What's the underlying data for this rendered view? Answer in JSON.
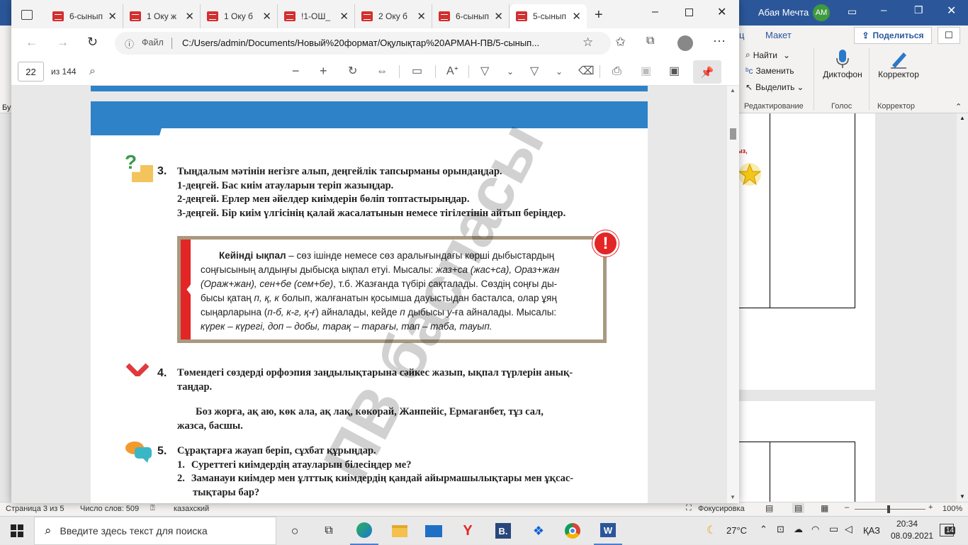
{
  "word": {
    "window_title": "Абая Мечта",
    "user_initials": "АМ",
    "tabs": [
      "ц",
      "Макет"
    ],
    "share_label": "Поделиться",
    "editing": {
      "find": "Найти",
      "replace": "Заменить",
      "select": "Выделить",
      "group": "Редактирование"
    },
    "voice": {
      "dictate": "Диктофон",
      "group": "Голос"
    },
    "editor": {
      "label": "Корректор",
      "group": "Корректор"
    },
    "left_cut": "Бу",
    "doc_fragment": "ыз,",
    "status": {
      "page": "Страница 3 из 5",
      "words": "Число слов: 509",
      "language": "казахский",
      "focus": "Фокусировка",
      "zoom": "100%"
    }
  },
  "edge": {
    "tabs": [
      "6-сынып",
      "1 Оку ж",
      "1 Оку б",
      "!1-ОШ_",
      "2 Оку б",
      "6-сынып",
      "5-сынып"
    ],
    "address": {
      "label": "Файл",
      "url": "C:/Users/admin/Documents/Новый%20формат/Оқулықтар%20АРМАН-ПВ/5-сынып..."
    },
    "pdf": {
      "page_current": "22",
      "page_total": "из 144"
    }
  },
  "pdf_page": {
    "task3": {
      "num": "3.",
      "lines": [
        "Тыңдалым мәтінін негізге алып, деңгейлік тапсырманы орындаңдар.",
        "1-деңгей. Бас киім атауларын теріп жазыңдар.",
        "2-деңгей. Ерлер мен әйелдер киімдерін бөліп топтастырыңдар.",
        "3-деңгей. Бір киім үлгісінің қалай жасалатынын немесе тігілетінін айтып беріңдер."
      ]
    },
    "rule": {
      "term": "Кейінді ықпал",
      "l1": " – сөз ішінде немесе сөз аралығындағы көрші дыбыстардың",
      "l2a": "соңғысының алдыңғы дыбысқа ықпал етуі. Мысалы: ",
      "l2b": "жаз+са (жас+са), Ораз+жан",
      "l3a": "(Ораж+жан), сен+бе (сем+бе)",
      "l3b": ", т.б. Жазғанда түбірі сақталады. Сөздің соңғы ды-",
      "l4a": "бысы қатаң ",
      "l4b": "п, қ, к",
      "l4c": " болып, жалғанатын қосымша дауыстыдан басталса, олар ұяң",
      "l5a": "сыңарларына (",
      "l5b": "п-б, к-г, қ-ғ",
      "l5c": ") айналады, кейде ",
      "l5d": "п",
      "l5e": " дыбысы ",
      "l5f": "у",
      "l5g": "-ға айналады. Мысалы:",
      "l6": "күрек – күрегі, доп – добы, тарақ – тарағы, тап – таба, тауып."
    },
    "task4": {
      "num": "4.",
      "line1": "Төмендегі сөздерді орфоэпия заңдылықтарына сәйкес жазып, ықпал түрлерін анық-",
      "line2": "таңдар.",
      "words1": "Боз жорға, ақ аю, көк ала, ақ лақ, көкорай, Жанпейіс, Ермағанбет, тұз сал,",
      "words2": "жазса, басшы."
    },
    "task5": {
      "num": "5.",
      "line1": "Сұрақтарға жауап беріп, сұхбат құрыңдар.",
      "q1n": "1.",
      "q1": "Суреттегі киімдердің атауларын білесіңдер ме?",
      "q2n": "2.",
      "q2a": "Заманауи киімдер мен ұлттық киімдердің қандай айырмашылықтары мен ұқсас-",
      "q2b": "тықтары бар?"
    },
    "watermark": "ПВ баспасы"
  },
  "taskbar": {
    "search_placeholder": "Введите здесь текст для поиска",
    "weather": "27°C",
    "lang": "ҚАЗ",
    "time": "20:34",
    "date": "08.09.2021",
    "notifications": "14"
  },
  "colors": {
    "word_blue": "#2b579a",
    "pdf_blue": "#2e82c8",
    "rule_red": "#e32526",
    "rule_frame": "#a89a80"
  }
}
